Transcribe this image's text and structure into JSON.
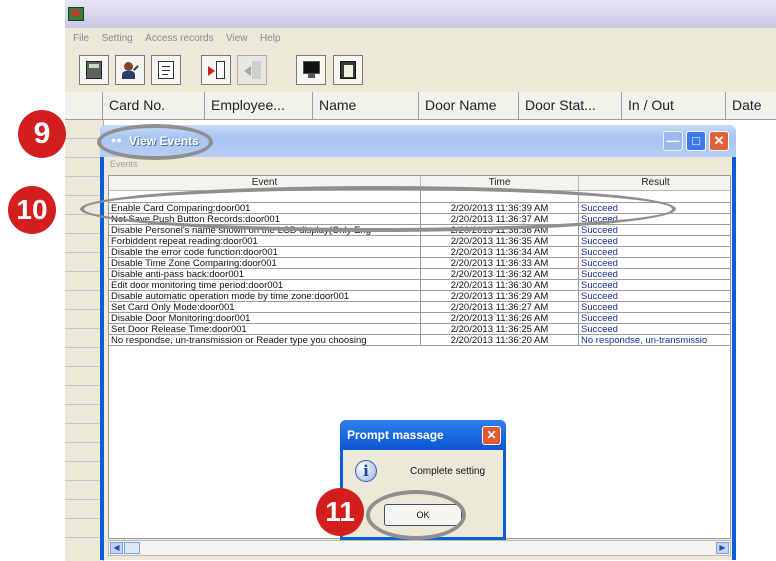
{
  "app": {
    "menu": [
      "File",
      "Setting",
      "Access records",
      "View",
      "Help"
    ],
    "columns": [
      "Card No.",
      "Employee...",
      "Name",
      "Door Name",
      "Door Stat...",
      "In / Out",
      "Date"
    ],
    "toolbar_icons": [
      "calculator-icon",
      "user-settings-icon",
      "report-icon",
      "import-icon",
      "export-icon",
      "monitor-icon",
      "clipboard-icon"
    ]
  },
  "window": {
    "title": "View Events",
    "group_label": "Events",
    "columns": [
      "Event",
      "Time",
      "Result"
    ],
    "rows": [
      {
        "event": "Enable Card Comparing:door001",
        "time": "2/20/2013 11:36:39 AM",
        "result": "Succeed"
      },
      {
        "event": "Not Save Push Button Records:door001",
        "time": "2/20/2013 11:36:37 AM",
        "result": "Succeed"
      },
      {
        "event": "Disable Personel's name shown on the LCD display(Only Eng",
        "time": "2/20/2013 11:36:36 AM",
        "result": "Succeed"
      },
      {
        "event": "Forbiddent repeat reading:door001",
        "time": "2/20/2013 11:36:35 AM",
        "result": "Succeed"
      },
      {
        "event": "Disable the error code function:door001",
        "time": "2/20/2013 11:36:34 AM",
        "result": "Succeed"
      },
      {
        "event": "Disable Time Zone Comparing:door001",
        "time": "2/20/2013 11:36:33 AM",
        "result": "Succeed"
      },
      {
        "event": "Disable anti-pass back:door001",
        "time": "2/20/2013 11:36:32 AM",
        "result": "Succeed"
      },
      {
        "event": "Edit door monitoring time period:door001",
        "time": "2/20/2013 11:36:30 AM",
        "result": "Succeed"
      },
      {
        "event": "Disable automatic operation mode by time zone:door001",
        "time": "2/20/2013 11:36:29 AM",
        "result": "Succeed"
      },
      {
        "event": "Set Card Only Mode:door001",
        "time": "2/20/2013 11:36:27 AM",
        "result": "Succeed"
      },
      {
        "event": "Disable Door Monitoring:door001",
        "time": "2/20/2013 11:36:26 AM",
        "result": "Succeed"
      },
      {
        "event": "Set Door Release Time:door001",
        "time": "2/20/2013 11:36:25 AM",
        "result": "Succeed"
      },
      {
        "event": "No respondse, un-transmission or Reader type you choosing",
        "time": "2/20/2013 11:36:20 AM",
        "result": "No respondse, un-transmissio"
      }
    ]
  },
  "dialog": {
    "title": "Prompt massage",
    "message": "Complete setting",
    "ok_label": "OK"
  },
  "callouts": {
    "step_9": "9",
    "step_10": "10",
    "step_11": "11"
  },
  "colors": {
    "callout_red": "#d41e1e",
    "xp_blue": "#0a5fd8",
    "result_blue": "#1a2fa8"
  }
}
